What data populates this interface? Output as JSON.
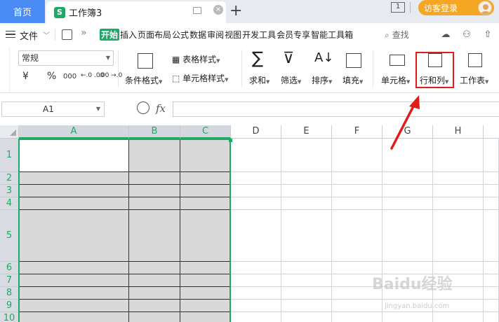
{
  "titlebar": {
    "home_tab": "首页",
    "doc_icon": "S",
    "doc_tab": "工作簿3",
    "close_glyph": "×",
    "add_glyph": "+",
    "window_count": "1",
    "login_label": "访客登录"
  },
  "menubar": {
    "file_label": "文件",
    "tabs": [
      "开始",
      "插入",
      "页面布局",
      "公式",
      "数据",
      "审阅",
      "视图",
      "开发工具",
      "会员专享",
      "智能工具箱"
    ],
    "active_tab": "开始",
    "search_label": "查找",
    "more_glyph": "»"
  },
  "ribbon": {
    "number_format": "常规",
    "number_buttons": [
      "¥",
      "%",
      "000",
      "←.0 .00",
      ".00 →.0"
    ],
    "conditional_format": "条件格式",
    "table_style": "表格样式",
    "cell_style": "单元格样式",
    "sum": "求和",
    "filter": "筛选",
    "sort": "排序",
    "fill": "填充",
    "cells": "单元格",
    "rows_cols": "行和列",
    "worksheet": "工作表"
  },
  "formula_bar": {
    "name_box": "A1",
    "fx": "fx",
    "value": ""
  },
  "grid": {
    "columns": [
      "A",
      "B",
      "C",
      "D",
      "E",
      "F",
      "G",
      "H"
    ],
    "selected_columns": [
      "A",
      "B",
      "C"
    ],
    "rows": [
      "1",
      "2",
      "3",
      "4",
      "5",
      "6",
      "7",
      "8",
      "9",
      "10"
    ],
    "active_cell": "A1"
  },
  "watermark": {
    "brand": "Baidu经验",
    "site": "jingyan.baidu.com"
  },
  "colors": {
    "accent_green": "#1fa967",
    "home_tab_blue": "#4a8bf5",
    "login_orange": "#f5a623",
    "annotation_red": "#e01b1b"
  }
}
